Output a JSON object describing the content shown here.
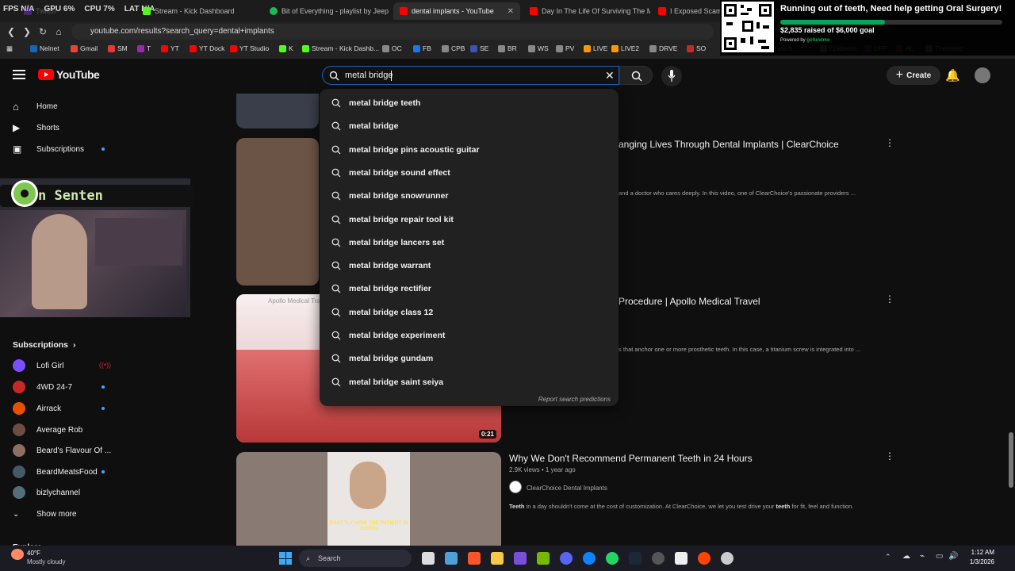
{
  "hud": {
    "fps_label": "FPS",
    "fps": "N/A",
    "gpu_label": "GPU",
    "gpu": "6%",
    "cpu_label": "CPU",
    "cpu": "7%",
    "lat_label": "LAT",
    "lat": "N/A"
  },
  "tabs": [
    {
      "label": "Twitch",
      "color": "#9146ff"
    },
    {
      "label": "Stream - Kick Dashboard",
      "color": "#53fc18"
    },
    {
      "label": "Bit of Everything - playlist by Jeep W",
      "color": "#1db954"
    },
    {
      "label": "dental implants - YouTube",
      "color": "#ff0000",
      "active": true
    },
    {
      "label": "Day In The Life Of Surviving The Mo",
      "color": "#ff0000"
    },
    {
      "label": "I Exposed Scamm",
      "color": "#ff0000"
    }
  ],
  "address": {
    "url": "youtube.com/results?search_query=dental+implants"
  },
  "bookmarks": [
    "Nelnet",
    "Gmail",
    "SM",
    "T",
    "YT",
    "YT Dock",
    "YT Studio",
    "K",
    "Stream - Kick Dashb...",
    "OC",
    "FB",
    "CPB",
    "SE",
    "BR",
    "WS",
    "PV",
    "LIVE",
    "LIVE2",
    "DRVE",
    "SO",
    "edule Twitch",
    "Epidemic",
    "UPP",
    "AL",
    "Thematic"
  ],
  "overlay": {
    "title": "Running out of teeth, Need help getting Oral Surgery!",
    "raised": "$2,835 raised of $6,000 goal",
    "powered": "Powered by",
    "powered_brand": "gofundme"
  },
  "youtube": {
    "logo": "YouTube",
    "search_value": "metal bridge",
    "create_label": "Create"
  },
  "sidebar": {
    "top": [
      {
        "label": "Home"
      },
      {
        "label": "Shorts"
      },
      {
        "label": "Subscriptions"
      }
    ],
    "subs_header": "Subscriptions",
    "channels": [
      {
        "label": "Lofi Girl",
        "color": "#7c4dff"
      },
      {
        "label": "4WD 24-7",
        "color": "#c62828"
      },
      {
        "label": "Airrack",
        "color": "#e65100"
      },
      {
        "label": "Average Rob",
        "color": "#6d4c41"
      },
      {
        "label": "Beard's Flavour Of ...",
        "color": "#8d6e63"
      },
      {
        "label": "BeardMeatsFood",
        "color": "#455a64"
      },
      {
        "label": "bizlychannel",
        "color": "#546e7a"
      }
    ],
    "show_more": "Show more",
    "explore": "Explore",
    "overlay_text": "n Senten"
  },
  "suggestions": [
    "metal bridge teeth",
    "metal bridge",
    "metal bridge pins acoustic guitar",
    "metal bridge sound effect",
    "metal bridge snowrunner",
    "metal bridge repair tool kit",
    "metal bridge lancers set",
    "metal bridge warrant",
    "metal bridge rectifier",
    "metal bridge class 12",
    "metal bridge experiment",
    "metal bridge gundam",
    "metal bridge saint seiya"
  ],
  "report": "Report search predictions",
  "videos": [
    {
      "title": "anging Lives Through Dental Implants | ClearChoice",
      "desc": "and a doctor who cares deeply. In this video, one of ClearChoice's passionate providers ..."
    },
    {
      "title": "Procedure | Apollo Medical Travel",
      "desc": "s that anchor one or more prosthetic teeth. In this case, a titanium screw is integrated into ...",
      "duration": "0:21",
      "thumb_text": "Apollo Medical Trav"
    },
    {
      "title": "Why We Don't Recommend Permanent  Teeth in 24 Hours",
      "meta": "2.9K views • 1 year ago",
      "channel": "ClearChoice Dental Implants",
      "desc_pre": "Teeth",
      "desc_mid": " in a day shouldn't come at the cost of customization. At ClearChoice, we let you test drive your ",
      "desc_b": "teeth",
      "desc_post": " for fit, feel and function.",
      "caption": "EXACTLY HOW THE PATIENT IS GOING"
    }
  ],
  "taskbar": {
    "temp": "40°F",
    "weather": "Mostly cloudy",
    "search": "Search",
    "time": "1:12 AM",
    "date": "1/3/2026"
  }
}
